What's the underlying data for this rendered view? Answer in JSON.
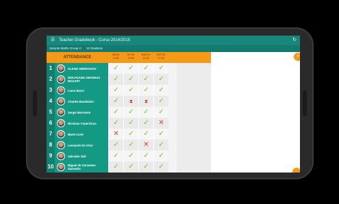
{
  "window": {
    "title": "Teacher Gradebook - Curso 2014/2015"
  },
  "subheader": {
    "group": "Sample Maths Group C",
    "students": "10 Students"
  },
  "attendance": {
    "header": "ATTENDANCE",
    "dates": [
      {
        "d": "5/6/15",
        "t": "11:58"
      },
      {
        "d": "5/7/15",
        "t": "10:50"
      },
      {
        "d": "5/20/15",
        "t": "11:33"
      },
      {
        "d": "5/27/15",
        "t": "17:40"
      }
    ]
  },
  "students": [
    {
      "n": "1",
      "name": "ALEXEI ABRIKOSOV",
      "marks": [
        "ok",
        "ok",
        "ok",
        "ok"
      ]
    },
    {
      "n": "2",
      "name": "WOLFGANG AMADEUS MOZART",
      "marks": [
        "ok",
        "ok",
        "ok",
        "ok"
      ]
    },
    {
      "n": "3",
      "name": "Laura Bassi",
      "marks": [
        "ok",
        "ok",
        "ok",
        "ok"
      ]
    },
    {
      "n": "4",
      "name": "Charles Baudelaire",
      "marks": [
        "ok",
        "late",
        "late",
        "ok"
      ]
    },
    {
      "n": "5",
      "name": "Sergei Bernstein",
      "marks": [
        "ok",
        "ok",
        "ok",
        "ok"
      ]
    },
    {
      "n": "6",
      "name": "Nicolaus Copernicus",
      "marks": [
        "ok",
        "ok",
        "ok",
        "no"
      ]
    },
    {
      "n": "7",
      "name": "Marie Curie",
      "marks": [
        "no",
        "ok",
        "ok",
        "ok"
      ]
    },
    {
      "n": "8",
      "name": "Leonardo Da Vinci",
      "marks": [
        "ok",
        "ok",
        "no",
        "ok"
      ]
    },
    {
      "n": "9",
      "name": "Salvador Dalí",
      "marks": [
        "ok",
        "ok",
        "ok",
        "ok"
      ]
    },
    {
      "n": "10",
      "name": "Miguel de Cervantes Saavedra",
      "marks": [
        "ok",
        "ok",
        "ok",
        "ok"
      ]
    }
  ],
  "icons": {
    "menu": "☰",
    "refresh": "↻",
    "close": "×",
    "ok": "✓",
    "no": "✕",
    "late": "⧗"
  }
}
